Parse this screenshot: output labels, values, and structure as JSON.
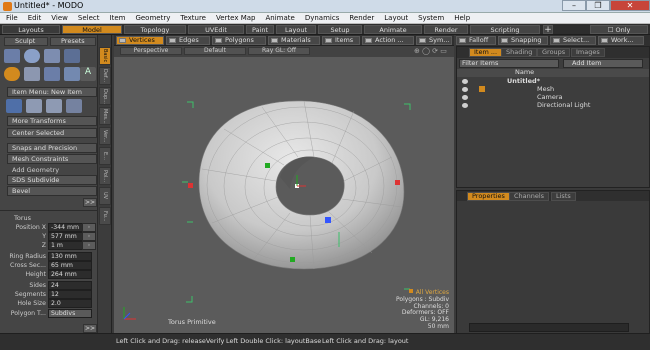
{
  "window": {
    "title": "Untitled* - MODO",
    "buttons": [
      "–",
      "❐",
      "✕"
    ]
  },
  "menu": [
    "File",
    "Edit",
    "View",
    "Select",
    "Item",
    "Geometry",
    "Texture",
    "Vertex Map",
    "Animate",
    "Dynamics",
    "Render",
    "Layout",
    "System",
    "Help"
  ],
  "layout_tabs": {
    "layouts_label": "Layouts",
    "tabs": [
      "Model",
      "Topology",
      "UVEdit",
      "Paint",
      "Layout",
      "Setup",
      "Animate",
      "Render",
      "Scripting"
    ],
    "active": "Model",
    "right_label": "Only"
  },
  "left_panel": {
    "sculpt_label": "Sculpt",
    "presets_label": "Presets",
    "item_menu": "Item Menu: New Item",
    "more_transforms": "More Transforms",
    "center_selected": "Center Selected",
    "snaps_precision": "Snaps and Precision",
    "mesh_constraints": "Mesh Constraints",
    "add_geometry": "Add Geometry",
    "sds_subdivide": "SDS Subdivide",
    "bevel": "Bevel",
    "torus_header": "Torus",
    "properties": [
      {
        "label": "Position X",
        "value": "-344 mm"
      },
      {
        "label": "Y",
        "value": "577 mm"
      },
      {
        "label": "Z",
        "value": "1 m"
      },
      {
        "label": "Ring Radius",
        "value": "130 mm"
      },
      {
        "label": "Cross Sec...",
        "value": "65 mm"
      },
      {
        "label": "Height",
        "value": "264 mm"
      },
      {
        "label": "Sides",
        "value": "24"
      },
      {
        "label": "Segments",
        "value": "12"
      },
      {
        "label": "Hole Size",
        "value": "2.0"
      },
      {
        "label": "Polygon T...",
        "value": "Subdivs"
      }
    ],
    "side_tabs": [
      "Basic",
      "Def...",
      "Dup...",
      "Mes...",
      "Ver...",
      "E...",
      "Pol...",
      "UV",
      "Fu..."
    ]
  },
  "viewport_toolbar": {
    "buttons": [
      "Vertices",
      "Edges",
      "Polygons",
      "Materials",
      "Items",
      "Action ...",
      "Sym...",
      "Falloff",
      "Snapping",
      "Select...",
      "Work..."
    ],
    "active": "Vertices"
  },
  "viewport_header": {
    "view": "Perspective",
    "style": "Default",
    "shading": "Ray GL: Off"
  },
  "viewport_overlay": {
    "all_vertices": "All Vertices",
    "polygons": "Polygons : Subdiv",
    "channels": "Channels: 0",
    "deformers": "Deformers: OFF",
    "gl": "GL: 9,216",
    "scale": "50 mm",
    "label": "Torus Primitive"
  },
  "item_list": {
    "tabs": [
      "Item ...",
      "Shading",
      "Groups",
      "Images"
    ],
    "filter_label": "Filter Items",
    "add_item": "Add Item",
    "column": "Name",
    "rows": [
      {
        "name": "Untitled*",
        "indent": 0
      },
      {
        "name": "Mesh",
        "indent": 1
      },
      {
        "name": "Camera",
        "indent": 1
      },
      {
        "name": "Directional Light",
        "indent": 1
      }
    ]
  },
  "properties_tabs": [
    "Properties",
    "Channels",
    "Lists"
  ],
  "status_bar": {
    "hint1": "Left Click and Drag: releaseVerify",
    "hint2": "Left Double Click: layoutBase",
    "hint3": "Left Click and Drag: layout"
  },
  "colors": {
    "accent": "#d28a1e",
    "viewport": "#5b5b5b",
    "panel": "#454545"
  }
}
